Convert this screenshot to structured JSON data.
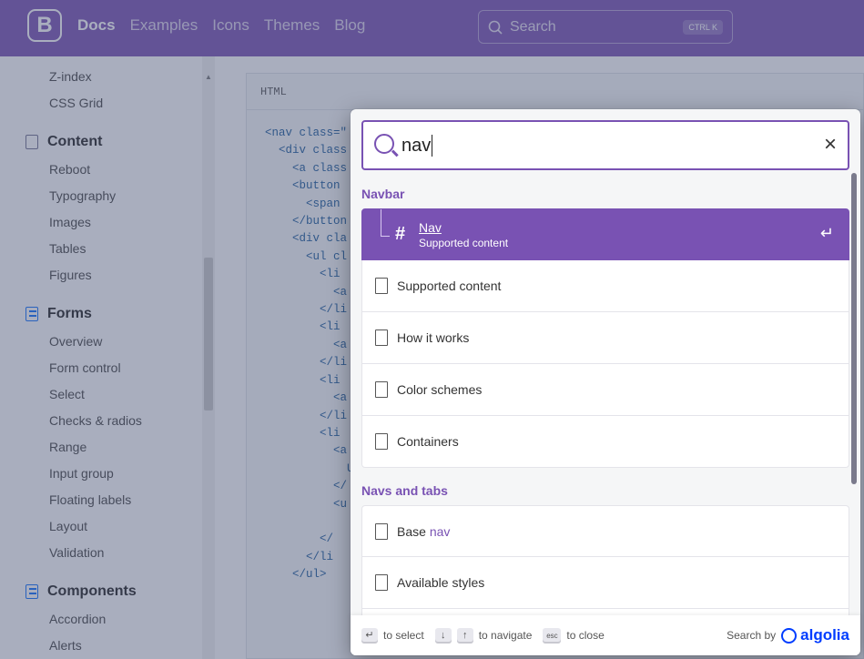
{
  "header": {
    "brand": "B",
    "nav": [
      "Docs",
      "Examples",
      "Icons",
      "Themes",
      "Blog"
    ],
    "search_placeholder": "Search",
    "shortcut": "CTRL K"
  },
  "sidebar": {
    "top_items": [
      "Z-index",
      "CSS Grid"
    ],
    "groups": [
      {
        "title": "Content",
        "icon": "file-icon",
        "items": [
          "Reboot",
          "Typography",
          "Images",
          "Tables",
          "Figures"
        ]
      },
      {
        "title": "Forms",
        "icon": "list-check-icon",
        "items": [
          "Overview",
          "Form control",
          "Select",
          "Checks & radios",
          "Range",
          "Input group",
          "Floating labels",
          "Layout",
          "Validation"
        ]
      },
      {
        "title": "Components",
        "icon": "collection-icon",
        "items": [
          "Accordion",
          "Alerts"
        ]
      }
    ]
  },
  "code": {
    "lang": "HTML",
    "lines": [
      "<nav class=\"",
      "  <div class",
      "    <a class",
      "    <button",
      "      <span",
      "    </button",
      "    <div cla",
      "      <ul cl",
      "        <li",
      "          <a",
      "        </li",
      "        <li",
      "          <a",
      "        </li",
      "        <li",
      "          <a",
      "        </li",
      "        <li",
      "          <a",
      "            U",
      "          </",
      "          <u",
      "",
      "        </",
      "      </li",
      "    </ul>"
    ]
  },
  "search": {
    "query": "nav",
    "clear_label": "×"
  },
  "results": [
    {
      "group": "Navbar",
      "hits": [
        {
          "title": "Nav",
          "subtitle": "Supported content",
          "selected": true,
          "icon": "hash-icon"
        },
        {
          "title": "Supported content",
          "icon": "doc-icon"
        },
        {
          "title": "How it works",
          "icon": "doc-icon"
        },
        {
          "title": "Color schemes",
          "icon": "doc-icon"
        },
        {
          "title": "Containers",
          "icon": "doc-icon"
        }
      ]
    },
    {
      "group": "Navs and tabs",
      "hits": [
        {
          "title": "Base",
          "highlight": "nav",
          "icon": "doc-icon"
        },
        {
          "title": "Available styles",
          "icon": "doc-icon"
        }
      ]
    }
  ],
  "footer": {
    "select": "to select",
    "navigate": "to navigate",
    "close": "to close",
    "esc": "esc",
    "powered": "Search by",
    "brand": "algolia"
  },
  "colors": {
    "accent": "#7952b3",
    "algolia": "#003dff"
  }
}
